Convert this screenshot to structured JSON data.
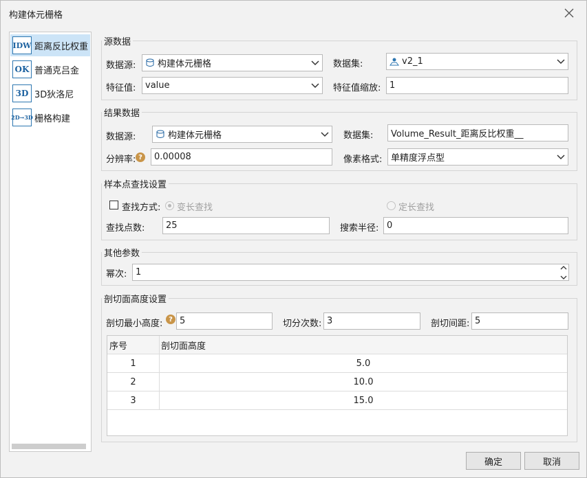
{
  "window": {
    "title": "构建体元栅格",
    "close_icon": "close-icon"
  },
  "nav": {
    "items": [
      {
        "icon_text": "IDW",
        "label": "距离反比权重",
        "selected": true
      },
      {
        "icon_text": "OK",
        "label": "普通克吕金",
        "selected": false
      },
      {
        "icon_text": "3D",
        "label": "3D狄洛尼",
        "selected": false
      },
      {
        "icon_text": "2D→3D",
        "label": "栅格构建",
        "selected": false
      }
    ]
  },
  "source": {
    "title": "源数据",
    "datasource_label": "数据源:",
    "datasource_value": "构建体元栅格",
    "dataset_label": "数据集:",
    "dataset_value": "v2_1",
    "field_label": "特征值:",
    "field_value": "value",
    "scale_label": "特征值缩放:",
    "scale_value": "1"
  },
  "result": {
    "title": "结果数据",
    "datasource_label": "数据源:",
    "datasource_value": "构建体元栅格",
    "dataset_label": "数据集:",
    "dataset_value": "Volume_Result_距离反比权重__",
    "resolution_label": "分辨率:",
    "resolution_value": "0.00008",
    "pixel_label": "像素格式:",
    "pixel_value": "单精度浮点型"
  },
  "sample": {
    "title": "样本点查找设置",
    "search_mode_label": "查找方式:",
    "variable_label": "变长查找",
    "fixed_label": "定长查找",
    "count_label": "查找点数:",
    "count_value": "25",
    "radius_label": "搜索半径:",
    "radius_value": "0"
  },
  "other": {
    "title": "其他参数",
    "power_label": "幂次:",
    "power_value": "1"
  },
  "section": {
    "title": "剖切面高度设置",
    "min_label": "剖切最小高度:",
    "min_value": "5",
    "count_label": "切分次数:",
    "count_value": "3",
    "interval_label": "剖切间距:",
    "interval_value": "5",
    "columns": [
      "序号",
      "剖切面高度"
    ],
    "rows": [
      [
        "1",
        "5.0"
      ],
      [
        "2",
        "10.0"
      ],
      [
        "3",
        "15.0"
      ]
    ]
  },
  "buttons": {
    "ok": "确定",
    "cancel": "取消"
  },
  "colors": {
    "accent": "#cce4f7",
    "icon_blue": "#1d62a0",
    "help": "#c99549"
  }
}
